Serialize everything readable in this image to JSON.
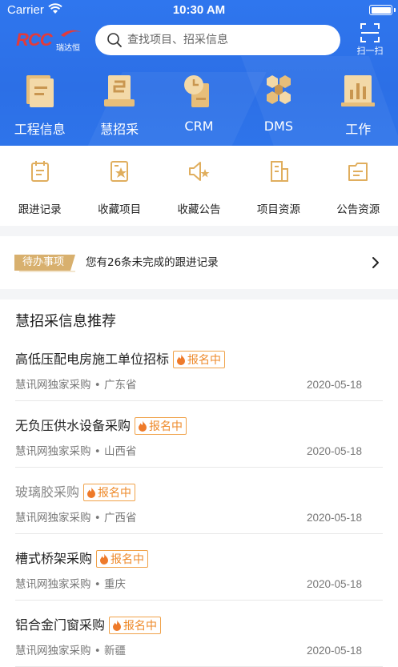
{
  "status_bar": {
    "carrier": "Carrier",
    "time": "10:30 AM"
  },
  "header": {
    "logo_text": "RCC",
    "logo_sub": "瑞达恒",
    "search_placeholder": "查找项目、招采信息",
    "scan_label": "扫一扫"
  },
  "main_nav": [
    {
      "label": "工程信息",
      "icon": "project-info-icon"
    },
    {
      "label": "慧招采",
      "icon": "procurement-icon"
    },
    {
      "label": "CRM",
      "icon": "crm-clock-icon"
    },
    {
      "label": "DMS",
      "icon": "dms-hexagon-icon"
    },
    {
      "label": "工作",
      "icon": "work-chart-icon"
    }
  ],
  "quick_menu": [
    {
      "label": "跟进记录",
      "icon": "follow-record-icon"
    },
    {
      "label": "收藏项目",
      "icon": "favorite-project-icon"
    },
    {
      "label": "收藏公告",
      "icon": "favorite-notice-icon"
    },
    {
      "label": "项目资源",
      "icon": "project-resource-icon"
    },
    {
      "label": "公告资源",
      "icon": "notice-resource-icon"
    }
  ],
  "todo": {
    "tag": "待办事项",
    "text": "您有26条未完成的跟进记录"
  },
  "recommend": {
    "title": "慧招采信息推荐",
    "items": [
      {
        "title": "高低压配电房施工单位招标",
        "badge": "报名中",
        "meta": "慧讯网独家采购 • 广东省",
        "date": "2020-05-18",
        "read": false
      },
      {
        "title": "无负压供水设备采购",
        "badge": "报名中",
        "meta": "慧讯网独家采购 • 山西省",
        "date": "2020-05-18",
        "read": false
      },
      {
        "title": "玻璃胶采购",
        "badge": "报名中",
        "meta": "慧讯网独家采购 • 广西省",
        "date": "2020-05-18",
        "read": true
      },
      {
        "title": "槽式桥架采购",
        "badge": "报名中",
        "meta": "慧讯网独家采购 • 重庆",
        "date": "2020-05-18",
        "read": false
      },
      {
        "title": "铝合金门窗采购",
        "badge": "报名中",
        "meta": "慧讯网独家采购 • 新疆",
        "date": "2020-05-18",
        "read": false
      }
    ]
  },
  "colors": {
    "primary": "#2e74ea",
    "icon_gold": "#e6b86a",
    "badge": "#ee8a2a",
    "tag": "#d8b06e"
  }
}
